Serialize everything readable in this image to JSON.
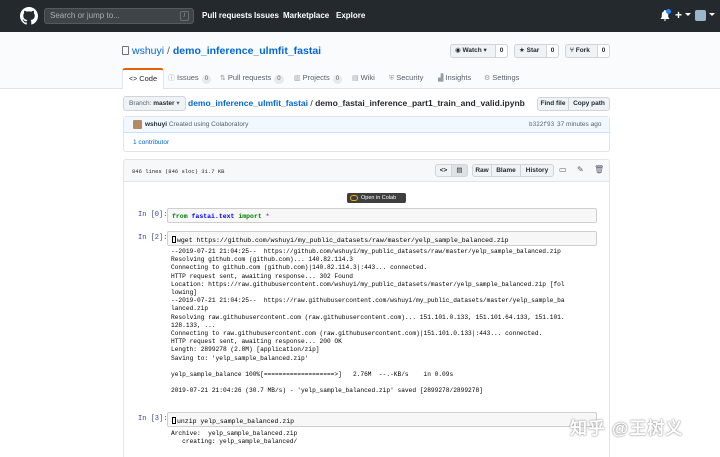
{
  "header": {
    "search_placeholder": "Search or jump to...",
    "search_key": "/",
    "nav": [
      "Pull requests",
      "Issues",
      "Marketplace",
      "Explore"
    ],
    "icons": [
      "github-logo-icon",
      "bell-icon",
      "plus-icon",
      "avatar"
    ]
  },
  "repo": {
    "owner": "wshuyi",
    "separator": "/",
    "name": "demo_inference_ulmfit_fastai",
    "watch": {
      "label": "Watch",
      "count": "0"
    },
    "star": {
      "label": "Star",
      "count": "0"
    },
    "fork": {
      "label": "Fork",
      "count": "0"
    }
  },
  "tabs": [
    {
      "label": "Code",
      "icon": "code-icon",
      "selected": true
    },
    {
      "label": "Issues",
      "count": "0",
      "icon": "issue-icon"
    },
    {
      "label": "Pull requests",
      "count": "0",
      "icon": "pr-icon"
    },
    {
      "label": "Projects",
      "count": "0",
      "icon": "project-icon"
    },
    {
      "label": "Wiki",
      "icon": "book-icon"
    },
    {
      "label": "Security",
      "icon": "shield-icon"
    },
    {
      "label": "Insights",
      "icon": "graph-icon"
    },
    {
      "label": "Settings",
      "icon": "gear-icon"
    }
  ],
  "filenav": {
    "branch_prefix": "Branch:",
    "branch": "master",
    "root": "demo_inference_ulmfit_fastai",
    "separator": "/",
    "file": "demo_fastai_inference_part1_train_and_valid.ipynb",
    "find_file": "Find file",
    "copy_path": "Copy path"
  },
  "commit": {
    "author": "wshuyi",
    "message": "Created using Colaboratory",
    "sha": "b322f93",
    "time": "37 minutes ago",
    "contributors": "1 contributor"
  },
  "file": {
    "info": "846 lines (846 sloc)   31.7 KB",
    "raw": "Raw",
    "blame": "Blame",
    "history": "History",
    "colab_label": "Open in Colab"
  },
  "notebook": {
    "cell0": {
      "prompt": "In [0]:",
      "tokens": [
        "from",
        "fastai.text",
        "import",
        "*"
      ]
    },
    "cell2": {
      "prompt": "In [2]:",
      "code": "wget https://github.com/wshuyi/my_public_datasets/raw/master/yelp_sample_balanced.zip",
      "output": "--2019-07-21 21:04:25--  https://github.com/wshuyi/my_public_datasets/raw/master/yelp_sample_balanced.zip\nResolving github.com (github.com)... 140.82.114.3\nConnecting to github.com (github.com)|140.82.114.3|:443... connected.\nHTTP request sent, awaiting response... 302 Found\nLocation: https://raw.githubusercontent.com/wshuyi/my_public_datasets/master/yelp_sample_balanced.zip [fol\nlowing]\n--2019-07-21 21:04:25--  https://raw.githubusercontent.com/wshuyi/my_public_datasets/master/yelp_sample_ba\nlanced.zip\nResolving raw.githubusercontent.com (raw.githubusercontent.com)... 151.101.0.133, 151.101.64.133, 151.101.\n128.133, ...\nConnecting to raw.githubusercontent.com (raw.githubusercontent.com)|151.101.0.133|:443... connected.\nHTTP request sent, awaiting response... 200 OK\nLength: 2899278 (2.8M) [application/zip]\nSaving to: 'yelp_sample_balanced.zip'\n\nyelp_sample_balance 100%[===================>]   2.76M  --.-KB/s    in 0.09s\n\n2019-07-21 21:04:26 (30.7 MB/s) - 'yelp_sample_balanced.zip' saved [2899278/2899278]"
    },
    "cell3": {
      "prompt": "In [3]:",
      "code": "unzip yelp_sample_balanced.zip",
      "output": "Archive:  yelp_sample_balanced.zip\n   creating: yelp_sample_balanced/"
    }
  },
  "watermark": "知乎 @王树义"
}
